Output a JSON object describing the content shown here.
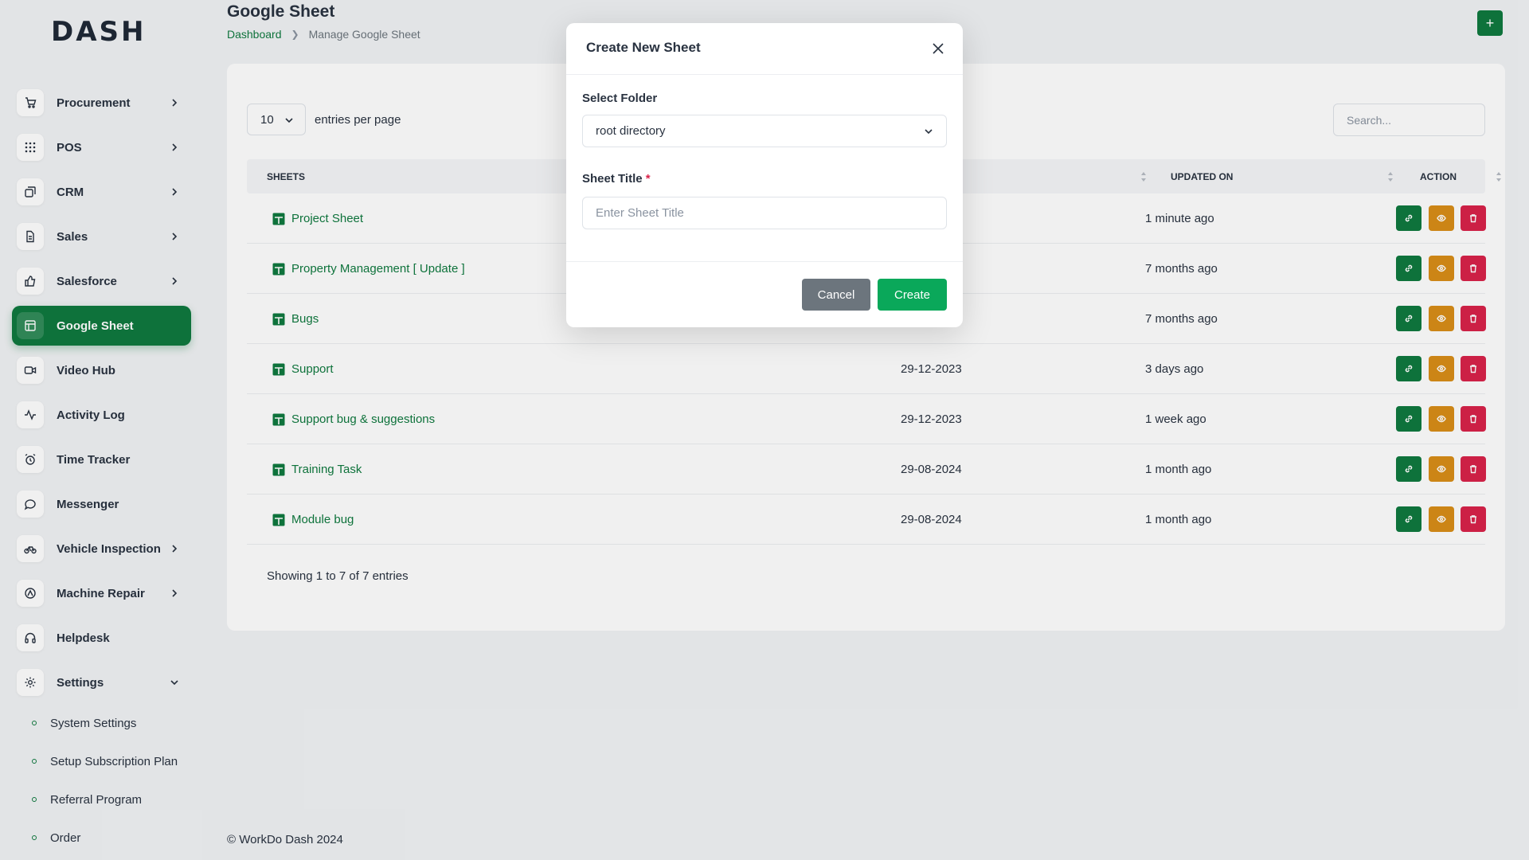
{
  "brand": {
    "logo_text": "DASH"
  },
  "sidebar": {
    "items": [
      {
        "label": "Procurement"
      },
      {
        "label": "POS"
      },
      {
        "label": "CRM"
      },
      {
        "label": "Sales"
      },
      {
        "label": "Salesforce"
      },
      {
        "label": "Google Sheet"
      },
      {
        "label": "Video Hub"
      },
      {
        "label": "Activity Log"
      },
      {
        "label": "Time Tracker"
      },
      {
        "label": "Messenger"
      },
      {
        "label": "Vehicle Inspection"
      },
      {
        "label": "Machine Repair"
      },
      {
        "label": "Helpdesk"
      },
      {
        "label": "Settings"
      }
    ],
    "sub_items": [
      {
        "label": "System Settings"
      },
      {
        "label": "Setup Subscription Plan"
      },
      {
        "label": "Referral Program"
      },
      {
        "label": "Order"
      }
    ]
  },
  "header": {
    "title": "Google Sheet",
    "breadcrumb": {
      "home": "Dashboard",
      "current": "Manage Google Sheet"
    },
    "add_button": "+"
  },
  "table": {
    "entries_value": "10",
    "entries_label": "entries per page",
    "search_placeholder": "Search...",
    "columns": {
      "sheets": "SHEETS",
      "updated_on": "UPDATED ON",
      "action": "ACTION"
    },
    "rows": [
      {
        "name": "Project Sheet",
        "created": "",
        "updated": "1 minute ago"
      },
      {
        "name": "Property Management [ Update ]",
        "created": "",
        "updated": "7 months ago"
      },
      {
        "name": "Bugs",
        "created": "",
        "updated": "7 months ago"
      },
      {
        "name": "Support",
        "created": "29-12-2023",
        "updated": "3 days ago"
      },
      {
        "name": "Support bug & suggestions",
        "created": "29-12-2023",
        "updated": "1 week ago"
      },
      {
        "name": "Training Task",
        "created": "29-08-2024",
        "updated": "1 month ago"
      },
      {
        "name": "Module bug",
        "created": "29-08-2024",
        "updated": "1 month ago"
      }
    ],
    "showing": "Showing 1 to 7 of 7 entries"
  },
  "footer": {
    "text": "© WorkDo Dash 2024"
  },
  "modal": {
    "title": "Create New Sheet",
    "folder_label": "Select Folder",
    "folder_value": "root directory",
    "title_label": "Sheet Title",
    "required_mark": "*",
    "title_placeholder": "Enter Sheet Title",
    "cancel_label": "Cancel",
    "create_label": "Create"
  },
  "colors": {
    "primary": "#0f7a3f",
    "warning": "#d98e18",
    "danger": "#d9234a",
    "create": "#0aa85a"
  }
}
